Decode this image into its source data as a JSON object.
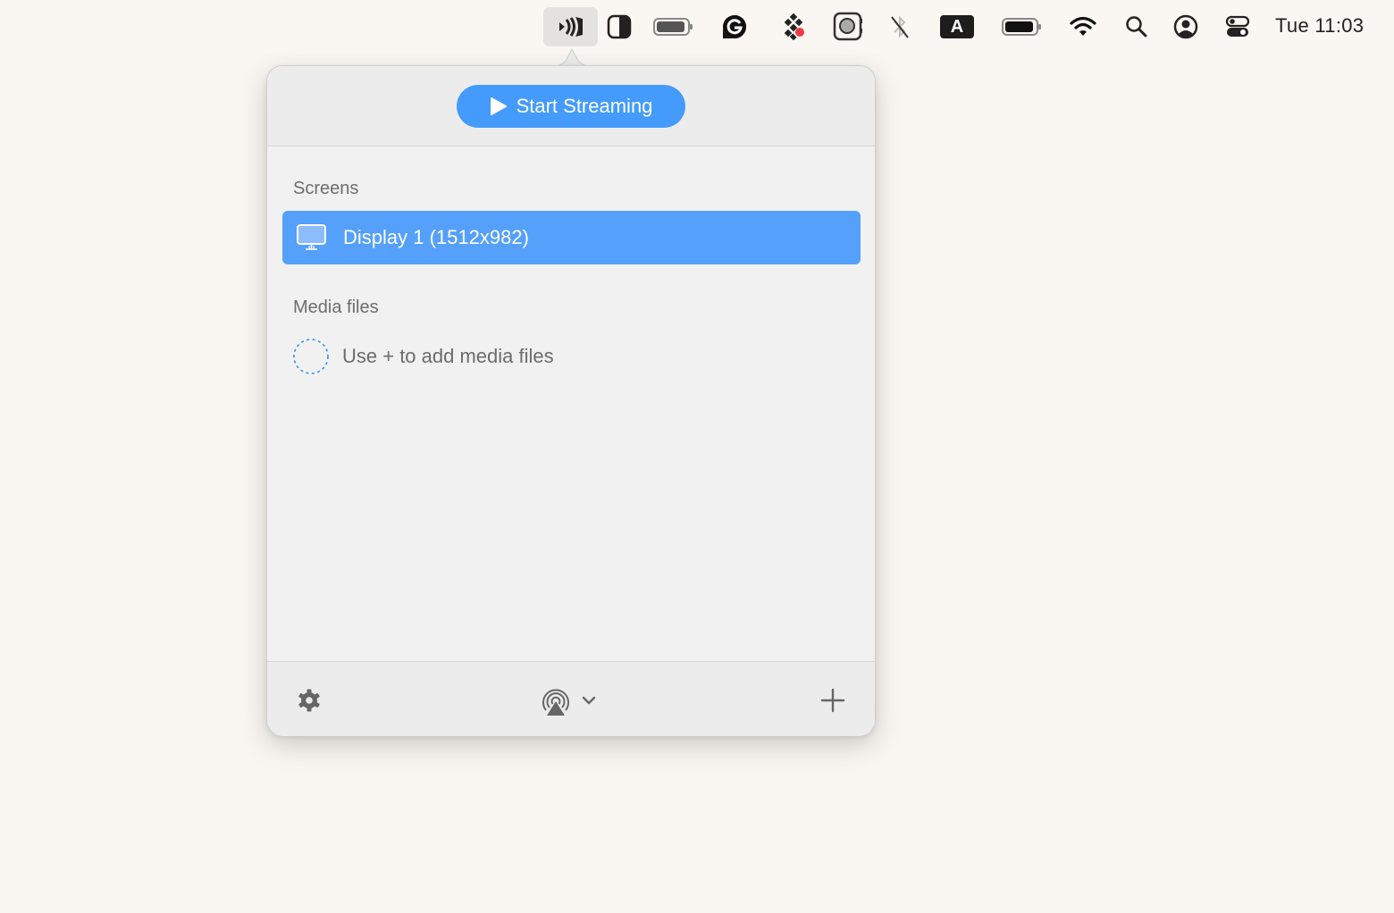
{
  "menubar": {
    "items": [
      {
        "name": "streaming-app-icon",
        "active": true
      },
      {
        "name": "display-contrast-icon"
      },
      {
        "name": "battery-icon-1"
      },
      {
        "name": "grammarly-icon"
      },
      {
        "name": "dots-app-icon"
      },
      {
        "name": "camera-app-icon"
      },
      {
        "name": "bluetooth-off-icon"
      },
      {
        "name": "input-source-icon",
        "label": "A"
      },
      {
        "name": "battery-icon-2"
      },
      {
        "name": "wifi-icon"
      },
      {
        "name": "spotlight-search-icon"
      },
      {
        "name": "user-account-icon"
      },
      {
        "name": "control-center-icon"
      }
    ],
    "clock": "Tue 11:03"
  },
  "popover": {
    "start_button_label": "Start Streaming",
    "screens_label": "Screens",
    "screens": [
      {
        "label": "Display 1 (1512x982)",
        "selected": true
      }
    ],
    "media_label": "Media files",
    "media_empty_text": "Use + to add media files",
    "footer": {
      "settings_icon": "gear-icon",
      "airplay_icon": "airplay-icon",
      "add_icon": "plus-icon"
    }
  },
  "colors": {
    "accent": "#449bfb",
    "selected_row": "#54a0fb",
    "background": "#f9f6f1"
  }
}
